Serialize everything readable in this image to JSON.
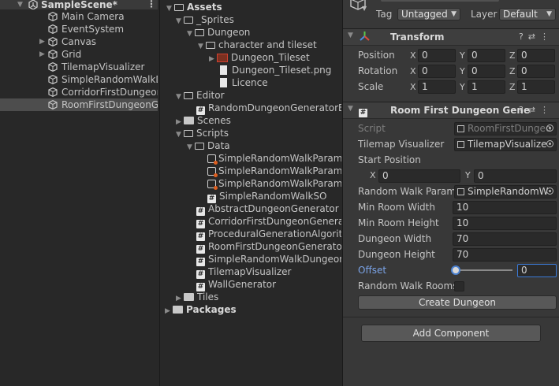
{
  "hierarchy": {
    "scene": "SampleScene*",
    "items": [
      {
        "label": "Main Camera",
        "has_children": false
      },
      {
        "label": "EventSystem",
        "has_children": false
      },
      {
        "label": "Canvas",
        "has_children": true
      },
      {
        "label": "Grid",
        "has_children": true
      },
      {
        "label": "TilemapVisualizer",
        "has_children": false
      },
      {
        "label": "SimpleRandomWalkD",
        "has_children": false
      },
      {
        "label": "CorridorFirstDungeon",
        "has_children": false
      },
      {
        "label": "RoomFirstDungeonGe",
        "has_children": false,
        "selected": true
      }
    ]
  },
  "project": {
    "assets_label": "Assets",
    "sprites_label": "_Sprites",
    "dungeon_label": "Dungeon",
    "char_tileset_label": "character and tileset",
    "dungeon_tileset_label": "Dungeon_Tileset",
    "dungeon_tileset_png_label": "Dungeon_Tileset.png",
    "licence_label": "Licence",
    "editor_label": "Editor",
    "rdg_editor_label": "RandomDungeonGeneratorEd",
    "scenes_label": "Scenes",
    "scripts_label": "Scripts",
    "data_label": "Data",
    "data_items": [
      "SimpleRandomWalkParame",
      "SimpleRandomWalkParame",
      "SimpleRandomWalkParame"
    ],
    "srw_so_label": "SimpleRandomWalkSO",
    "script_items": [
      "AbstractDungeonGenerator",
      "CorridorFirstDungeonGenerato",
      "ProceduralGenerationAlgorith",
      "RoomFirstDungeonGenerator",
      "SimpleRandomWalkDungeonG",
      "TilemapVisualizer",
      "WallGenerator"
    ],
    "tiles_label": "Tiles",
    "packages_label": "Packages"
  },
  "inspector": {
    "tag_label": "Tag",
    "tag_value": "Untagged",
    "layer_label": "Layer",
    "layer_value": "Default",
    "transform": {
      "title": "Transform",
      "position_label": "Position",
      "rotation_label": "Rotation",
      "scale_label": "Scale",
      "position": {
        "x": "0",
        "y": "0",
        "z": "0"
      },
      "rotation": {
        "x": "0",
        "y": "0",
        "z": "0"
      },
      "scale": {
        "x": "1",
        "y": "1",
        "z": "1"
      },
      "axis_x": "X",
      "axis_y": "Y",
      "axis_z": "Z"
    },
    "component": {
      "title": "Room First Dungeon Gene",
      "script_label": "Script",
      "script_value": "RoomFirstDungeo",
      "tilemap_label": "Tilemap Visualizer",
      "tilemap_value": "TilemapVisualize",
      "start_position_label": "Start Position",
      "start_x_label": "X",
      "start_x": "0",
      "start_y_label": "Y",
      "start_y": "0",
      "rw_params_label": "Random Walk Parame",
      "rw_params_value": "SimpleRandomW",
      "min_room_width_label": "Min Room Width",
      "min_room_width": "10",
      "min_room_height_label": "Min Room Height",
      "min_room_height": "10",
      "dungeon_width_label": "Dungeon Width",
      "dungeon_width": "70",
      "dungeon_height_label": "Dungeon Height",
      "dungeon_height": "70",
      "offset_label": "Offset",
      "offset_value": "0",
      "offset_slider_fraction": 0,
      "random_walk_rooms_label": "Random Walk Rooms",
      "random_walk_rooms_checked": false,
      "create_button": "Create Dungeon"
    },
    "add_component_button": "Add Component"
  }
}
